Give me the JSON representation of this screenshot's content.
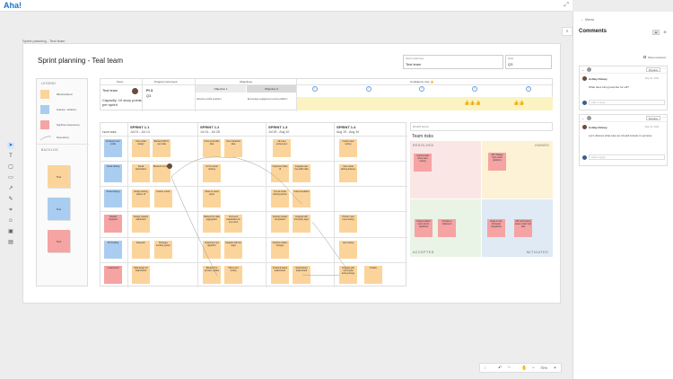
{
  "app": {
    "logo": "Aha!",
    "expand_icon": "expand-icon"
  },
  "breadcrumb": "Sprint planning - Teal team",
  "board": {
    "title": "Sprint planning - Teal team",
    "fields": [
      {
        "label": "Sprint planning",
        "value": "Teal team"
      },
      {
        "label": "Date",
        "value": "Q3"
      }
    ]
  },
  "legend": {
    "title": "LEGEND",
    "items": [
      {
        "label": "Milestone/Event",
        "color": "#fbd49b"
      },
      {
        "label": "Features - Enablers",
        "color": "#a9cdf1"
      },
      {
        "label": "Significant dependency",
        "color": "#f5a3a3"
      },
      {
        "label": "Dependency",
        "color": "#888888"
      }
    ]
  },
  "backlog": {
    "title": "BACKLOG",
    "cards": [
      {
        "label": "Text",
        "color": "#fbd49b"
      },
      {
        "label": "Text",
        "color": "#a9cdf1"
      },
      {
        "label": "Text",
        "color": "#f5a3a3"
      }
    ]
  },
  "header_table": {
    "columns": [
      "Team",
      "Program increment",
      "Objectives",
      "Confidence vote 👍"
    ],
    "team_name": "Teal team",
    "pi_label": "PI 3",
    "pi_quarter": "Q3",
    "capacity": "Capacity: 10 story points per sprint",
    "objectives": [
      {
        "label": "Objective 1",
        "text": "Advance profile analytics"
      },
      {
        "label": "Objective 2",
        "text": "Encourage engagement across platform"
      }
    ],
    "vote_options": [
      "1",
      "2",
      "3",
      "4",
      "5"
    ]
  },
  "sprints": [
    {
      "name": "SPRINT 1.1",
      "dates": "Jul 01 - Jul 14"
    },
    {
      "name": "SPRINT 1.2",
      "dates": "Jul 14 - Jul 28"
    },
    {
      "name": "SPRINT 1.3",
      "dates": "Jul 29 - Aug 10"
    },
    {
      "name": "SPRINT 1.4",
      "dates": "Aug 19 - Aug 34"
    }
  ],
  "features_label": "FEATURES",
  "features": [
    "Enhanced user profile",
    "Social sharing",
    "Social badging",
    "Reward programs",
    "API tracking",
    "Leaderboard"
  ],
  "tasks": [
    [
      "User profile design",
      "Backend API for user data",
      "Front-end profile data",
      "User interaction data",
      "Add user preferences",
      "Content user testing"
    ],
    [
      "Social optimization",
      "Backend services",
      "UX for social sharing",
      "Implement share UI",
      "Integrate user buy-traffic data",
      "User social sharing features"
    ],
    [
      "Design sharing options UI",
      "Feature mocks",
      "Share to social option",
      "Test all social sharing options",
      "Collect feedback"
    ],
    [
      "Design rewards dashboard",
      "Backend for data aggregation",
      "Front-end visualization for any result",
      "Develop reward computation",
      "Integrate with third-party apps",
      "Perform user event testing"
    ],
    [
      "Research",
      "Prototype tracking system",
      "Implement new algorithm",
      "Integrate with live maps",
      "Optimize tracker changes",
      "User testing"
    ],
    [
      "Data design for leaderboard",
      "Backend for dynamic update",
      "Filters and sorting",
      "Frontend based leaderboard",
      "Email-based leaderboard",
      "Integrate with user profile achievements",
      "Finalize"
    ]
  ],
  "risks": {
    "header": "ROAM board",
    "title": "Team risks",
    "quadrants": [
      "RESOLVED",
      "OWNED",
      "ACCEPTED",
      "MITIGATED"
    ],
    "notes": [
      {
        "text": "Improve load times more testing",
        "quad": "RESOLVED"
      },
      {
        "text": "API changes from social platforms",
        "quad": "OWNED"
      },
      {
        "text": "Implementation team can be significant",
        "quad": "ACCEPTED"
      },
      {
        "text": "Compile to implement",
        "quad": "ACCEPTED"
      },
      {
        "text": "Delay on the third-party integrations",
        "quad": "MITIGATED"
      },
      {
        "text": "API performance issues under high load",
        "quad": "MITIGATED"
      }
    ]
  },
  "comments_panel": {
    "menu_label": "Menu",
    "title": "Comments",
    "show_resolved": "Show resolved",
    "threads": [
      {
        "author": "Ashley Kinney",
        "time": "May 10, 2024",
        "text": "What does hiring look like for H2?",
        "resolve_label": "Resolve",
        "reply_placeholder": "Add a reply..."
      },
      {
        "author": "Ashley Kinney",
        "time": "May 10, 2024",
        "text": "Let's discuss what else we should include in services.",
        "resolve_label": "Resolve",
        "reply_placeholder": "Add a reply..."
      }
    ]
  },
  "bottom_toolbar": {
    "zoom": "75%"
  }
}
